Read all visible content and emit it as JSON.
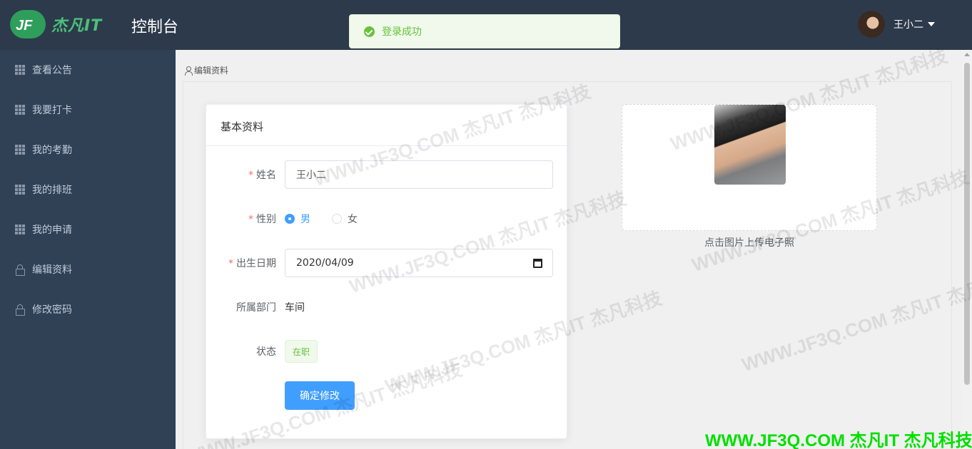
{
  "header": {
    "logo_text": "杰凡IT",
    "title": "控制台",
    "user_name": "王小二"
  },
  "toast": {
    "message": "登录成功"
  },
  "sidebar": {
    "items": [
      {
        "label": "查看公告",
        "icon": "grid-icon"
      },
      {
        "label": "我要打卡",
        "icon": "grid-icon"
      },
      {
        "label": "我的考勤",
        "icon": "grid-icon"
      },
      {
        "label": "我的排班",
        "icon": "grid-icon"
      },
      {
        "label": "我的申请",
        "icon": "grid-icon"
      },
      {
        "label": "编辑资料",
        "icon": "lock-icon"
      },
      {
        "label": "修改密码",
        "icon": "lock-icon"
      }
    ]
  },
  "breadcrumb": {
    "label": "编辑资料"
  },
  "form": {
    "card_title": "基本资料",
    "required_mark": "*",
    "name_label": "姓名",
    "name_value": "王小二",
    "gender_label": "性别",
    "gender_options": [
      "男",
      "女"
    ],
    "gender_selected": "男",
    "birth_label": "出生日期",
    "birth_value": "2020/04/09",
    "dept_label": "所属部门",
    "dept_value": "车间",
    "status_label": "状态",
    "status_value": "在职",
    "submit_label": "确定修改"
  },
  "upload": {
    "hint": "点击图片上传电子照"
  },
  "watermark": {
    "text": "WWW.JF3Q.COM 杰凡IT 杰凡科技",
    "footer": "WWW.JF3Q.COM 杰凡IT 杰凡科技"
  },
  "colors": {
    "primary": "#409eff",
    "success": "#67c23a",
    "sidebar": "#304156",
    "topbar": "#2d3a4b",
    "required": "#f56c6c"
  }
}
